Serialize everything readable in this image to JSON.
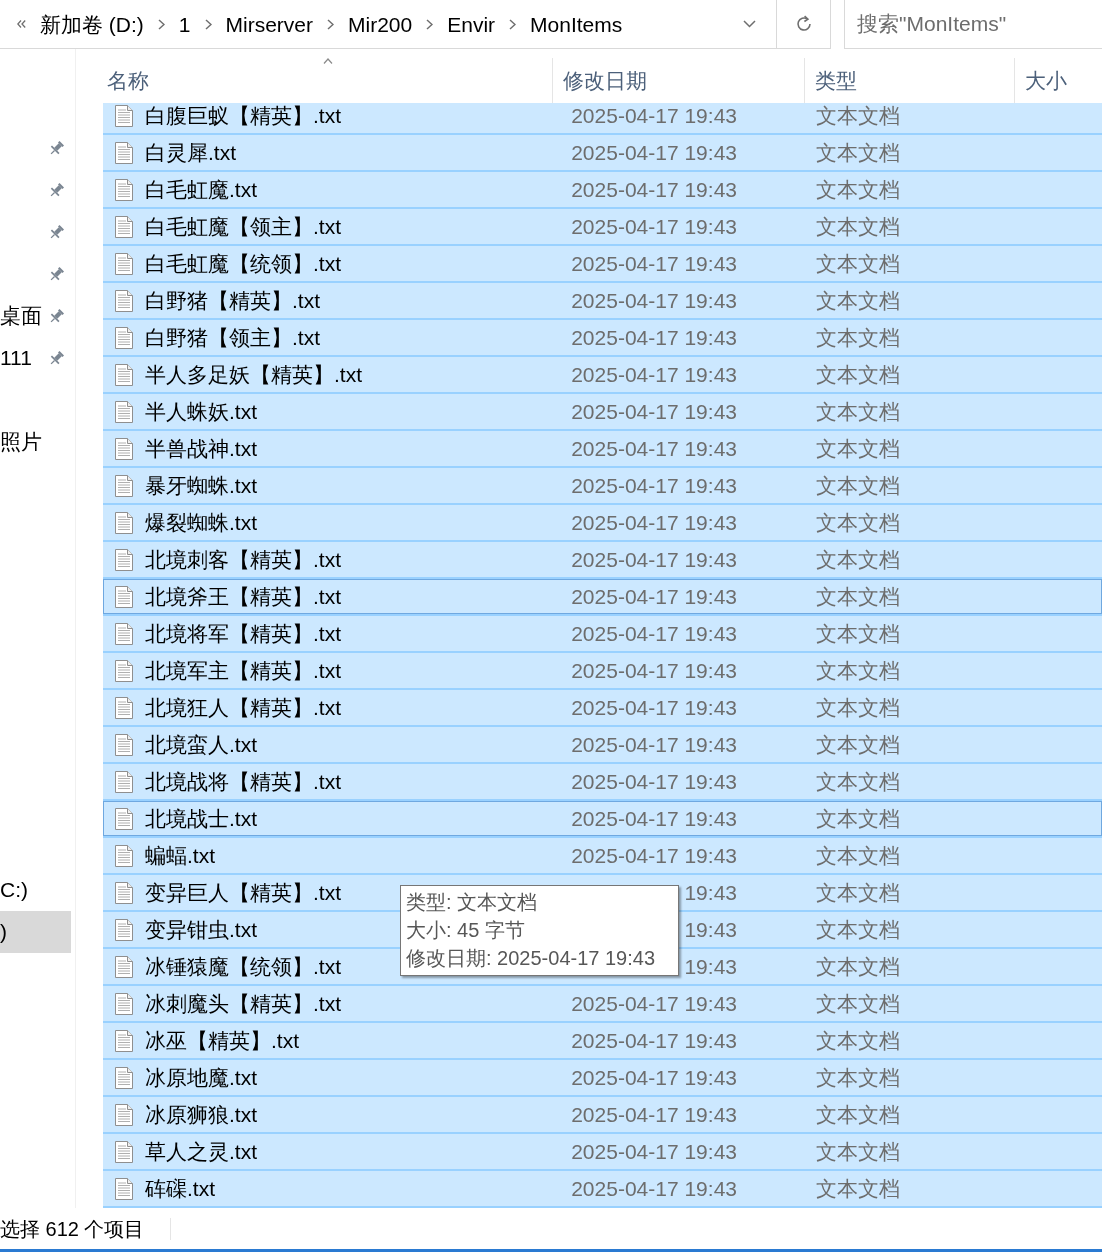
{
  "address_bar": {
    "breadcrumb": [
      {
        "label": "新加卷 (D:)"
      },
      {
        "label": "1"
      },
      {
        "label": "Mirserver"
      },
      {
        "label": "Mir200"
      },
      {
        "label": "Envir"
      },
      {
        "label": "MonItems"
      }
    ],
    "search": {
      "placeholder": "搜索\"MonItems\""
    }
  },
  "nav_pane": {
    "groups": [
      {
        "items": [
          {
            "pinned": true,
            "selected": false
          },
          {
            "pinned": true,
            "selected": false
          },
          {
            "pinned": true,
            "selected": false
          },
          {
            "pinned": true,
            "selected": false
          },
          {
            "label": "桌面",
            "pinned": true,
            "selected": false
          },
          {
            "label": "111",
            "pinned": true,
            "selected": false
          }
        ]
      },
      {
        "items": [
          {
            "label": "照片",
            "pinned": false,
            "selected": false
          }
        ]
      },
      {
        "items": [
          {
            "label": "C:)",
            "pinned": false,
            "selected": false
          },
          {
            "label": ")",
            "pinned": false,
            "selected": true
          }
        ]
      }
    ]
  },
  "file_list": {
    "columns": [
      {
        "label": "名称",
        "sorted": true
      },
      {
        "label": "修改日期",
        "sorted": false
      },
      {
        "label": "类型",
        "sorted": false
      },
      {
        "label": "大小",
        "sorted": false
      }
    ],
    "rows": [
      {
        "name": "白腹巨蚁【精英】.txt",
        "modified": "2025-04-17 19:43",
        "type": "文本文档",
        "selected": true,
        "focused": false
      },
      {
        "name": "白灵犀.txt",
        "modified": "2025-04-17 19:43",
        "type": "文本文档",
        "selected": true,
        "focused": false
      },
      {
        "name": "白毛虹魔.txt",
        "modified": "2025-04-17 19:43",
        "type": "文本文档",
        "selected": true,
        "focused": false
      },
      {
        "name": "白毛虹魔【领主】.txt",
        "modified": "2025-04-17 19:43",
        "type": "文本文档",
        "selected": true,
        "focused": false
      },
      {
        "name": "白毛虹魔【统领】.txt",
        "modified": "2025-04-17 19:43",
        "type": "文本文档",
        "selected": true,
        "focused": false
      },
      {
        "name": "白野猪【精英】.txt",
        "modified": "2025-04-17 19:43",
        "type": "文本文档",
        "selected": true,
        "focused": false
      },
      {
        "name": "白野猪【领主】.txt",
        "modified": "2025-04-17 19:43",
        "type": "文本文档",
        "selected": true,
        "focused": false
      },
      {
        "name": "半人多足妖【精英】.txt",
        "modified": "2025-04-17 19:43",
        "type": "文本文档",
        "selected": true,
        "focused": false
      },
      {
        "name": "半人蛛妖.txt",
        "modified": "2025-04-17 19:43",
        "type": "文本文档",
        "selected": true,
        "focused": false
      },
      {
        "name": "半兽战神.txt",
        "modified": "2025-04-17 19:43",
        "type": "文本文档",
        "selected": true,
        "focused": false
      },
      {
        "name": "暴牙蜘蛛.txt",
        "modified": "2025-04-17 19:43",
        "type": "文本文档",
        "selected": true,
        "focused": false
      },
      {
        "name": "爆裂蜘蛛.txt",
        "modified": "2025-04-17 19:43",
        "type": "文本文档",
        "selected": true,
        "focused": false
      },
      {
        "name": "北境刺客【精英】.txt",
        "modified": "2025-04-17 19:43",
        "type": "文本文档",
        "selected": true,
        "focused": false
      },
      {
        "name": "北境斧王【精英】.txt",
        "modified": "2025-04-17 19:43",
        "type": "文本文档",
        "selected": true,
        "focused": true
      },
      {
        "name": "北境将军【精英】.txt",
        "modified": "2025-04-17 19:43",
        "type": "文本文档",
        "selected": true,
        "focused": false
      },
      {
        "name": "北境军主【精英】.txt",
        "modified": "2025-04-17 19:43",
        "type": "文本文档",
        "selected": true,
        "focused": false
      },
      {
        "name": "北境狂人【精英】.txt",
        "modified": "2025-04-17 19:43",
        "type": "文本文档",
        "selected": true,
        "focused": false
      },
      {
        "name": "北境蛮人.txt",
        "modified": "2025-04-17 19:43",
        "type": "文本文档",
        "selected": true,
        "focused": false
      },
      {
        "name": "北境战将【精英】.txt",
        "modified": "2025-04-17 19:43",
        "type": "文本文档",
        "selected": true,
        "focused": false
      },
      {
        "name": "北境战士.txt",
        "modified": "2025-04-17 19:43",
        "type": "文本文档",
        "selected": true,
        "focused": true
      },
      {
        "name": "蝙蝠.txt",
        "modified": "2025-04-17 19:43",
        "type": "文本文档",
        "selected": true,
        "focused": false
      },
      {
        "name": "变异巨人【精英】.txt",
        "modified": "19:43",
        "type": "文本文档",
        "selected": true,
        "focused": false
      },
      {
        "name": "变异钳虫.txt",
        "modified": "19:43",
        "type": "文本文档",
        "selected": true,
        "focused": false
      },
      {
        "name": "冰锤猿魔【统领】.txt",
        "modified": "19:43",
        "type": "文本文档",
        "selected": true,
        "focused": false
      },
      {
        "name": "冰刺魔头【精英】.txt",
        "modified": "2025-04-17 19:43",
        "type": "文本文档",
        "selected": true,
        "focused": false
      },
      {
        "name": "冰巫【精英】.txt",
        "modified": "2025-04-17 19:43",
        "type": "文本文档",
        "selected": true,
        "focused": false
      },
      {
        "name": "冰原地魔.txt",
        "modified": "2025-04-17 19:43",
        "type": "文本文档",
        "selected": true,
        "focused": false
      },
      {
        "name": "冰原狮狼.txt",
        "modified": "2025-04-17 19:43",
        "type": "文本文档",
        "selected": true,
        "focused": false
      },
      {
        "name": "草人之灵.txt",
        "modified": "2025-04-17 19:43",
        "type": "文本文档",
        "selected": true,
        "focused": false
      },
      {
        "name": "砗磲.txt",
        "modified": "2025-04-17 19:43",
        "type": "文本文档",
        "selected": true,
        "focused": false
      }
    ]
  },
  "tooltip": {
    "lines": [
      "类型: 文本文档",
      "大小: 45 字节",
      "修改日期: 2025-04-17 19:43"
    ]
  },
  "status_bar": {
    "text": "选择 612 个项目"
  }
}
